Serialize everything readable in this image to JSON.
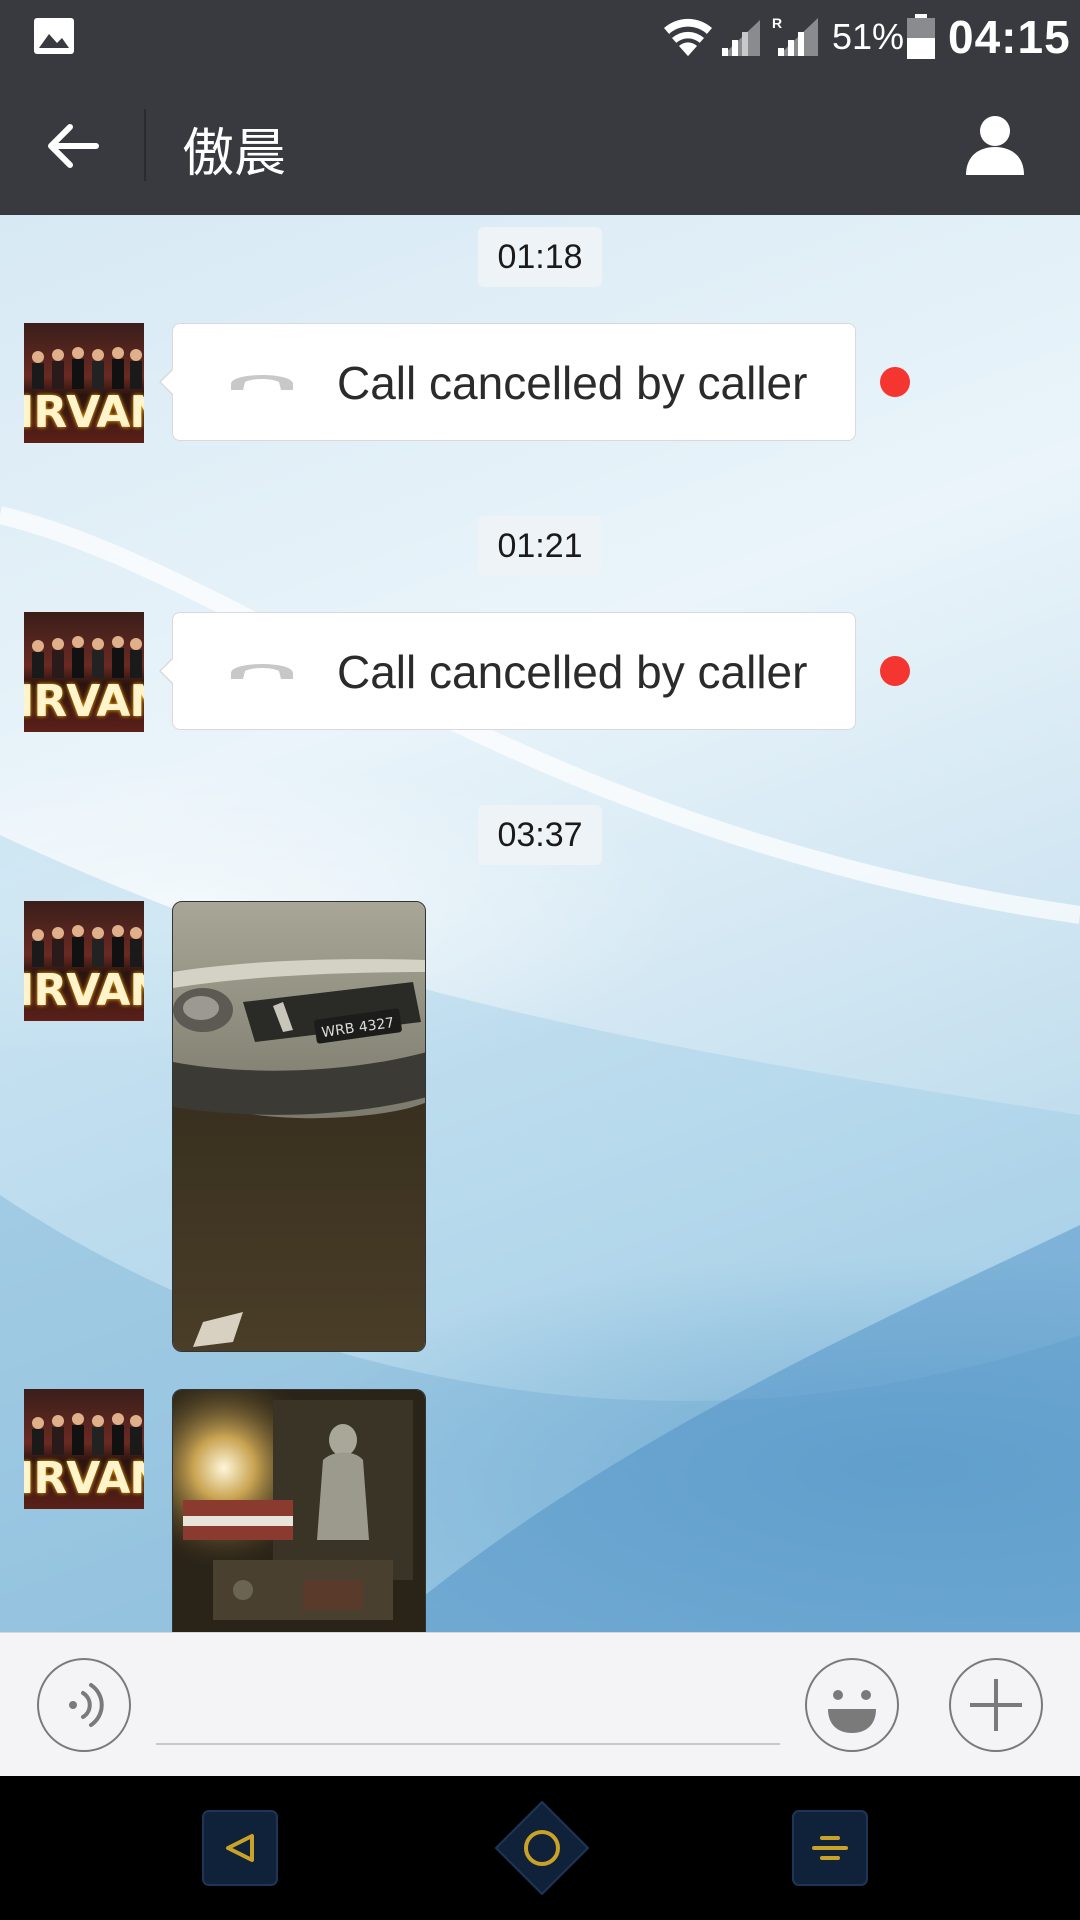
{
  "status_bar": {
    "battery_percent": "51%",
    "time": "04:15",
    "roaming_indicator": "R",
    "icons": [
      "gallery-icon",
      "wifi-icon",
      "signal-icon",
      "signal-roaming-icon",
      "battery-icon"
    ]
  },
  "header": {
    "back_icon": "arrow-left-icon",
    "title": "傲晨",
    "profile_icon": "person-icon"
  },
  "chat": {
    "messages": [
      {
        "type": "timestamp",
        "text": "01:18"
      },
      {
        "type": "call",
        "sender_avatar_text": "IRVANA",
        "text": "Call cancelled by caller",
        "icon": "phone-hangup-icon",
        "unread": true
      },
      {
        "type": "timestamp",
        "text": "01:21"
      },
      {
        "type": "call",
        "sender_avatar_text": "IRVANA",
        "text": "Call cancelled by caller",
        "icon": "phone-hangup-icon",
        "unread": true
      },
      {
        "type": "timestamp",
        "text": "03:37"
      },
      {
        "type": "image",
        "sender_avatar_text": "IRVANA",
        "image_alt": "Night photo of a silver car front bumper"
      },
      {
        "type": "image",
        "sender_avatar_text": "IRVANA",
        "image_alt": "Night photo of a dashboard with a small figurine"
      }
    ]
  },
  "input_bar": {
    "voice_icon": "voice-icon",
    "message_value": "",
    "emoji_icon": "emoji-icon",
    "more_icon": "plus-icon"
  },
  "nav_bar": {
    "icons": [
      "nav-back-icon",
      "nav-home-icon",
      "nav-menu-icon"
    ]
  },
  "colors": {
    "header_bg": "#393a3f",
    "unread_dot": "#f43530",
    "input_bar_bg": "#f4f4f6",
    "nav_accent": "#c9a227"
  }
}
